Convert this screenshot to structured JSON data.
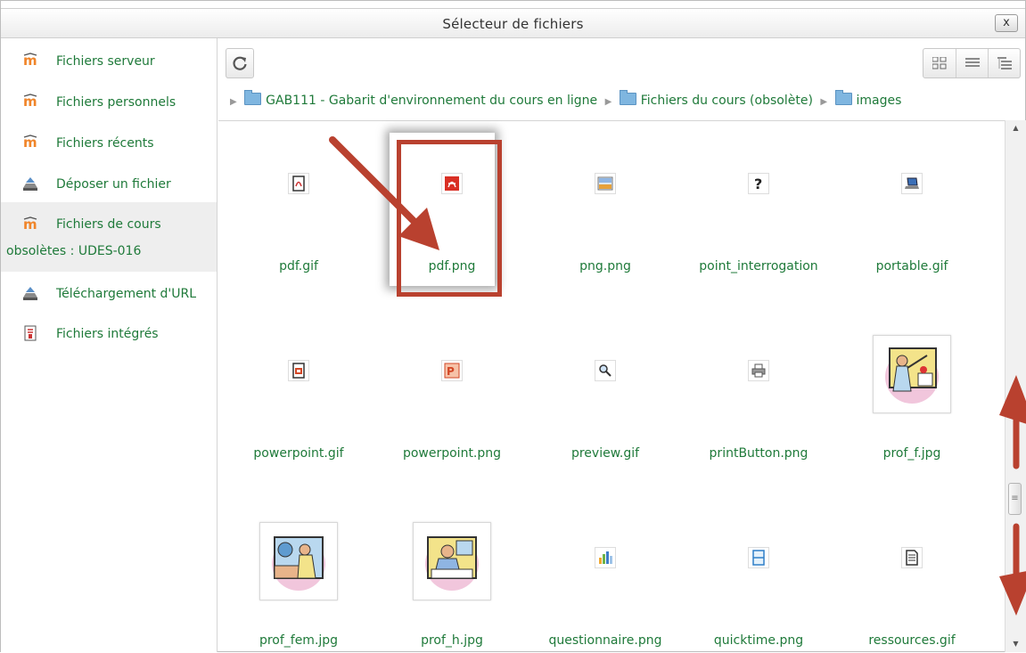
{
  "dialog": {
    "title": "Sélecteur de fichiers",
    "close_label": "x"
  },
  "sidebar": {
    "items": [
      {
        "label": "Fichiers serveur",
        "icon": "moodle-icon"
      },
      {
        "label": "Fichiers personnels",
        "icon": "moodle-icon"
      },
      {
        "label": "Fichiers récents",
        "icon": "moodle-icon"
      },
      {
        "label": "Déposer un fichier",
        "icon": "upload-icon"
      },
      {
        "label_line1": "Fichiers de cours",
        "label_line2": "obsolètes : UDES-016",
        "icon": "moodle-icon",
        "active": true
      },
      {
        "label": "Téléchargement d'URL",
        "icon": "upload-icon"
      },
      {
        "label": "Fichiers intégrés",
        "icon": "embedded-files-icon"
      }
    ]
  },
  "toolbar": {
    "refresh_icon": "refresh-icon",
    "view_icons": [
      "grid-view-icon",
      "list-view-icon",
      "tree-view-icon"
    ]
  },
  "path": {
    "segments": [
      "GAB111 - Gabarit d'environnement du cours en ligne",
      "Fichiers du cours (obsolète)",
      "images"
    ]
  },
  "files": [
    {
      "name": "pdf.gif",
      "icon": "pdf-doc-icon"
    },
    {
      "name": "pdf.png",
      "icon": "pdf-icon"
    },
    {
      "name": "png.png",
      "icon": "image-icon"
    },
    {
      "name": "point_interrogation",
      "icon": "question-icon"
    },
    {
      "name": "portable.gif",
      "icon": "laptop-icon"
    },
    {
      "name": "powerpoint.gif",
      "icon": "powerpoint-doc-icon"
    },
    {
      "name": "powerpoint.png",
      "icon": "powerpoint-icon"
    },
    {
      "name": "preview.gif",
      "icon": "magnifier-icon"
    },
    {
      "name": "printButton.png",
      "icon": "printer-icon"
    },
    {
      "name": "prof_f.jpg",
      "icon": "teacher-female-clipart"
    },
    {
      "name": "prof_fem.jpg",
      "icon": "teacher-desk-clipart"
    },
    {
      "name": "prof_h.jpg",
      "icon": "teacher-male-clipart"
    },
    {
      "name": "questionnaire.png",
      "icon": "bar-chart-icon"
    },
    {
      "name": "quicktime.png",
      "icon": "film-icon"
    },
    {
      "name": "ressources.gif",
      "icon": "document-icon"
    }
  ],
  "colors": {
    "link_green": "#1f7a3a",
    "annotation_red": "#b9412f",
    "moodle_orange": "#f0852a"
  }
}
